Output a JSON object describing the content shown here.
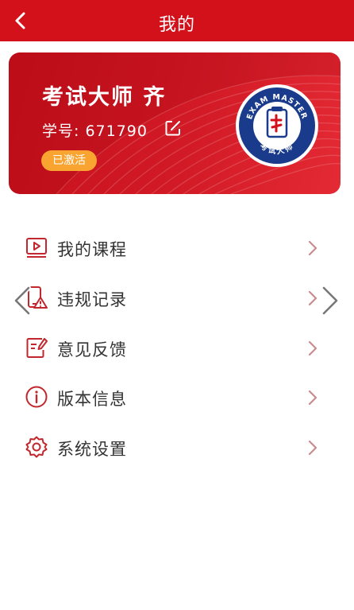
{
  "header": {
    "title": "我的"
  },
  "profile": {
    "name": "考试大师 齐",
    "student_id_label": "学号:",
    "student_id": "671790",
    "status_badge": "已激活",
    "logo_text_top": "EXAM MASTER",
    "logo_text_bottom": "考试大师"
  },
  "menu": {
    "items": [
      {
        "label": "我的课程",
        "icon": "video-course-icon"
      },
      {
        "label": "违规记录",
        "icon": "phone-warning-icon"
      },
      {
        "label": "意见反馈",
        "icon": "feedback-edit-icon"
      },
      {
        "label": "版本信息",
        "icon": "info-icon"
      },
      {
        "label": "系统设置",
        "icon": "gear-icon"
      }
    ]
  },
  "colors": {
    "primary": "#d3111b",
    "badge": "#f9a431",
    "icon": "#c1272d",
    "logo_blue": "#1a3b8c"
  }
}
